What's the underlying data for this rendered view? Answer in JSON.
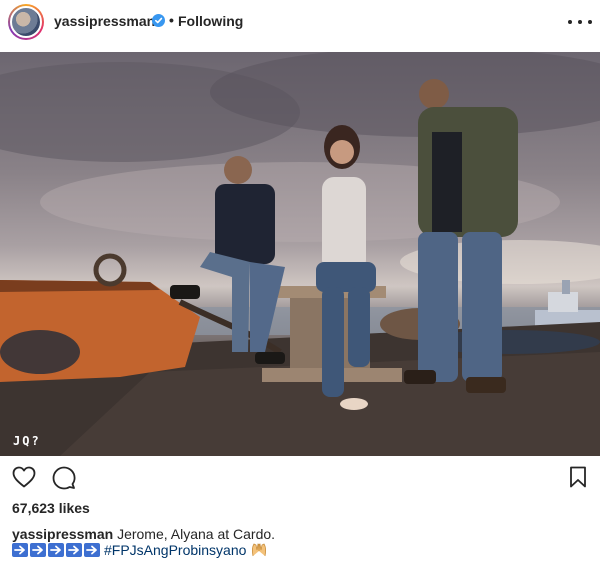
{
  "header": {
    "username": "yassipressman",
    "separator": "•",
    "follow_status": "Following"
  },
  "photo": {
    "watermark": "JQ?"
  },
  "icons": {
    "like": "heart-icon",
    "comment": "comment-icon",
    "save": "bookmark-icon",
    "more": "more-options-icon",
    "verified": "verified-badge-icon"
  },
  "stats": {
    "likes": "67,623 likes"
  },
  "caption": {
    "username": "yassipressman",
    "text": " Jerome, Alyana at Cardo.",
    "arrow_count": 5,
    "hashtag": "#FPJsAngProbinsyano",
    "emoji": "🙌"
  },
  "colors": {
    "verified": "#3897f0",
    "text": "#262626",
    "hashtag": "#003569",
    "arrow_emoji": "#3d6fd1"
  }
}
